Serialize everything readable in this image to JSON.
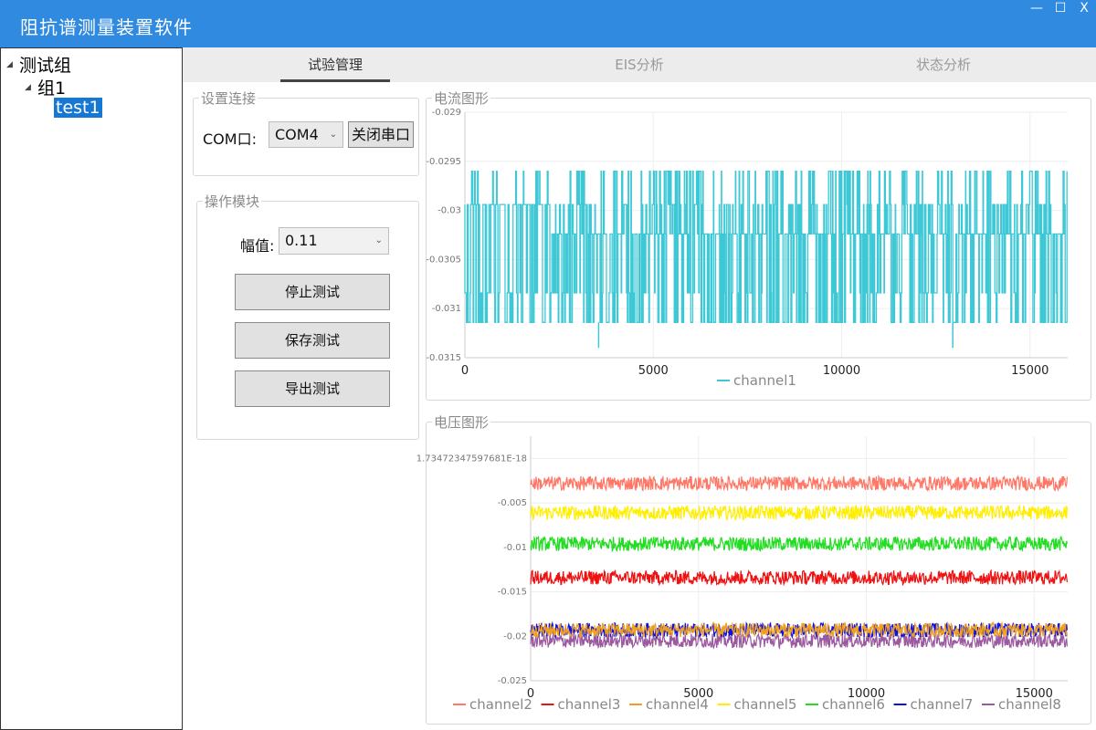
{
  "window": {
    "title": "阻抗谱测量装置软件",
    "controls": {
      "minimize": "—",
      "maximize": "☐",
      "close": "X"
    }
  },
  "tree": {
    "root": "测试组",
    "group": "组1",
    "item": "test1"
  },
  "tabs": [
    {
      "label": "试验管理",
      "active": true
    },
    {
      "label": "EIS分析",
      "active": false
    },
    {
      "label": "状态分析",
      "active": false
    }
  ],
  "connect": {
    "title": "设置连接",
    "com_label": "COM口:",
    "com_value": "COM4",
    "close_button": "关闭串口"
  },
  "ops": {
    "title": "操作模块",
    "amp_label": "幅值:",
    "amp_value": "0.11",
    "stop_button": "停止测试",
    "save_button": "保存测试",
    "export_button": "导出测试"
  },
  "colors": {
    "titlebar": "#2f8ae0",
    "channel1": "#3ec8d6"
  },
  "chart_data": [
    {
      "type": "line",
      "title": "电流图形",
      "xlim": [
        0,
        16000
      ],
      "ylim": [
        -0.0315,
        -0.029
      ],
      "x_ticks": [
        "0",
        "5000",
        "10000",
        "15000"
      ],
      "y_ticks": [
        "-0.029",
        "-0.0295",
        "-0.03",
        "-0.0305",
        "-0.031",
        "-0.0315"
      ],
      "legend_position": "bottom",
      "grid": true,
      "series": [
        {
          "name": "channel1",
          "color": "#3ec8d6",
          "levels": [
            -0.0296,
            -0.02994,
            -0.03024,
            -0.03084,
            -0.03114
          ],
          "spikes": [
            {
              "x": 3550,
              "y": -0.0314
            },
            {
              "x": 12950,
              "y": -0.0314
            }
          ]
        }
      ]
    },
    {
      "type": "line",
      "title": "电压图形",
      "xlim": [
        0,
        16000
      ],
      "ylim": [
        -0.025,
        0.0025
      ],
      "x_ticks": [
        "0",
        "5000",
        "10000",
        "15000"
      ],
      "y_ticks": [
        "1.73472347597681E-18",
        "-0.005",
        "-0.01",
        "-0.015",
        "-0.02",
        "-0.025"
      ],
      "legend_position": "bottom",
      "grid": true,
      "series": [
        {
          "name": "channel2",
          "color": "#ff7766",
          "mean": -0.0028
        },
        {
          "name": "channel3",
          "color": "#ee1111",
          "mean": -0.0134
        },
        {
          "name": "channel4",
          "color": "#f0a020",
          "mean": -0.0193
        },
        {
          "name": "channel5",
          "color": "#ffee00",
          "mean": -0.0061
        },
        {
          "name": "channel6",
          "color": "#22dd22",
          "mean": -0.0096
        },
        {
          "name": "channel7",
          "color": "#1111dd",
          "mean": -0.0193
        },
        {
          "name": "channel8",
          "color": "#9b59a0",
          "mean": -0.0205
        }
      ]
    }
  ]
}
